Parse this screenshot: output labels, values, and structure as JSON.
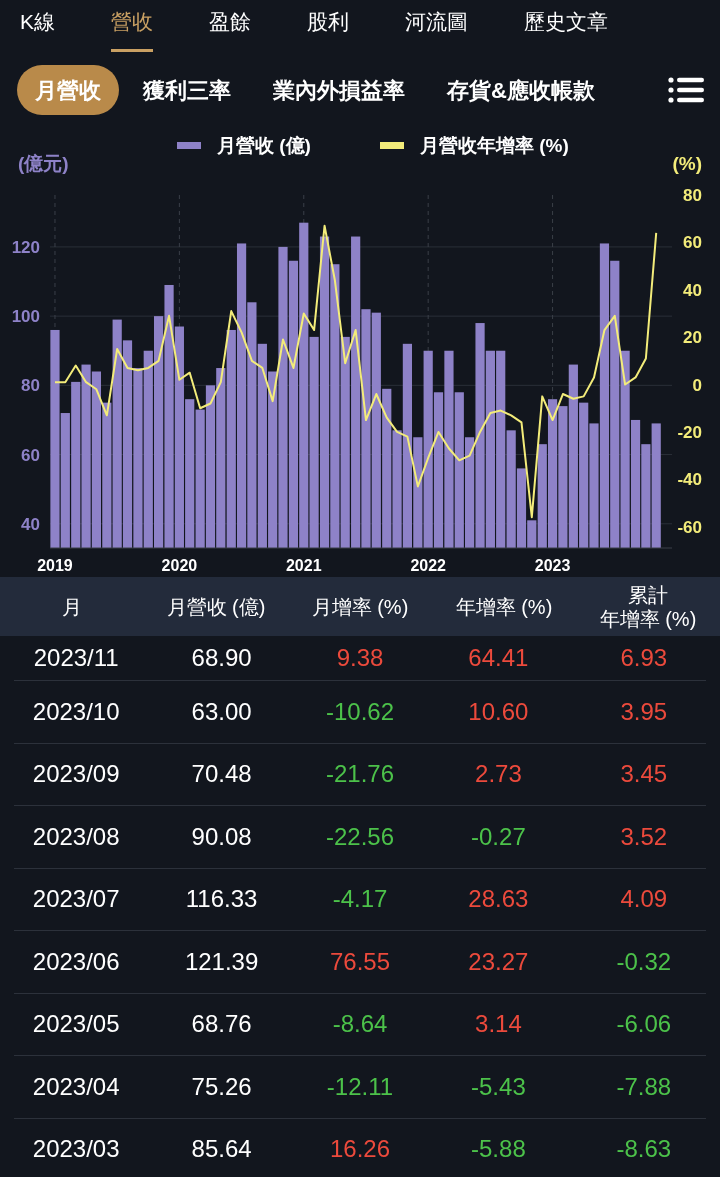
{
  "top_tabs": [
    {
      "label": "K線",
      "selected": false
    },
    {
      "label": "營收",
      "selected": true
    },
    {
      "label": "盈餘",
      "selected": false
    },
    {
      "label": "股利",
      "selected": false
    },
    {
      "label": "河流圖",
      "selected": false
    },
    {
      "label": "歷史文章",
      "selected": false
    }
  ],
  "sub_tabs": [
    {
      "label": "月營收",
      "selected": true
    },
    {
      "label": "獲利三率",
      "selected": false
    },
    {
      "label": "業內外損益率",
      "selected": false
    },
    {
      "label": "存貨&應收帳款",
      "selected": false
    }
  ],
  "charts": [
    {
      "chart_data": {
        "type": "bar",
        "grid": true,
        "ylabel": "(億元)",
        "xlim": [
          2018.96,
          2023.96
        ],
        "ylim": [
          33,
          135
        ],
        "yticks": [
          40,
          60,
          80,
          100,
          120
        ],
        "xticks": [
          2019,
          2020,
          2021,
          2022,
          2023
        ],
        "x": [
          2019,
          2019.083,
          2019.167,
          2019.25,
          2019.333,
          2019.417,
          2019.5,
          2019.583,
          2019.667,
          2019.75,
          2019.833,
          2019.917,
          2020,
          2020.083,
          2020.167,
          2020.25,
          2020.333,
          2020.417,
          2020.5,
          2020.583,
          2020.667,
          2020.75,
          2020.833,
          2020.917,
          2021,
          2021.083,
          2021.167,
          2021.25,
          2021.333,
          2021.417,
          2021.5,
          2021.583,
          2021.667,
          2021.75,
          2021.833,
          2021.917,
          2022,
          2022.083,
          2022.167,
          2022.25,
          2022.333,
          2022.417,
          2022.5,
          2022.583,
          2022.667,
          2022.75,
          2022.833,
          2022.917,
          2023,
          2023.083,
          2023.167,
          2023.25,
          2023.333,
          2023.417,
          2023.5,
          2023.583,
          2023.667,
          2023.75,
          2023.833
        ],
        "series": [
          {
            "name": "月營收 (億)",
            "color": "#8e82c8",
            "values": [
              96,
              72,
              81,
              86,
              84,
              75,
              99,
              93,
              85,
              90,
              100,
              109,
              97,
              76,
              73,
              80,
              85,
              96,
              121,
              104,
              92,
              84,
              120,
              116,
              127,
              94,
              123,
              115,
              94,
              123,
              102,
              101,
              79,
              67,
              92,
              65,
              90,
              78,
              90,
              78,
              65,
              98,
              90,
              90,
              67,
              56,
              41,
              63,
              76,
              74,
              86,
              75,
              69,
              121,
              116,
              90,
              70,
              63,
              69
            ]
          }
        ]
      }
    },
    {
      "chart_data": {
        "type": "line",
        "ylabel": "(%)",
        "ylim": [
          -69,
          80
        ],
        "yticks": [
          -60,
          -40,
          -20,
          0,
          20,
          40,
          60,
          80
        ],
        "series": [
          {
            "name": "月營收年增率 (%)",
            "color": "#f3ec7a",
            "values": [
              1,
              1,
              8,
              1,
              -2,
              -13,
              15,
              7,
              6,
              7,
              10,
              29,
              2,
              5,
              -10,
              -8,
              1,
              31,
              22,
              10,
              7,
              -7,
              19,
              7,
              30,
              23,
              67,
              44,
              9,
              23,
              -15,
              -4,
              -14,
              -20,
              -22,
              -43,
              -31,
              -20,
              -27,
              -32,
              -30,
              -20,
              -12,
              -11,
              -13,
              -16,
              -56,
              -5,
              -15,
              -4,
              -6,
              -5,
              3,
              23,
              29,
              0,
              3,
              11,
              64
            ]
          }
        ]
      }
    }
  ],
  "table": {
    "columns": [
      {
        "lines": [
          "月"
        ]
      },
      {
        "lines": [
          "月營收 (億)"
        ]
      },
      {
        "lines": [
          "月增率 (%)"
        ]
      },
      {
        "lines": [
          "年增率 (%)"
        ]
      },
      {
        "lines": [
          "累計",
          "年增率 (%)"
        ]
      }
    ],
    "rows": [
      {
        "cells": [
          {
            "text": "2023/11",
            "color": "#ffffff"
          },
          {
            "text": "68.90",
            "color": "#ffffff"
          },
          {
            "text": "9.38",
            "color": "#ec4a3c"
          },
          {
            "text": "64.41",
            "color": "#ec4a3c"
          },
          {
            "text": "6.93",
            "color": "#ec4a3c"
          }
        ]
      },
      {
        "cells": [
          {
            "text": "2023/10",
            "color": "#ffffff"
          },
          {
            "text": "63.00",
            "color": "#ffffff"
          },
          {
            "text": "-10.62",
            "color": "#4cc24a"
          },
          {
            "text": "10.60",
            "color": "#ec4a3c"
          },
          {
            "text": "3.95",
            "color": "#ec4a3c"
          }
        ]
      },
      {
        "cells": [
          {
            "text": "2023/09",
            "color": "#ffffff"
          },
          {
            "text": "70.48",
            "color": "#ffffff"
          },
          {
            "text": "-21.76",
            "color": "#4cc24a"
          },
          {
            "text": "2.73",
            "color": "#ec4a3c"
          },
          {
            "text": "3.45",
            "color": "#ec4a3c"
          }
        ]
      },
      {
        "cells": [
          {
            "text": "2023/08",
            "color": "#ffffff"
          },
          {
            "text": "90.08",
            "color": "#ffffff"
          },
          {
            "text": "-22.56",
            "color": "#4cc24a"
          },
          {
            "text": "-0.27",
            "color": "#4cc24a"
          },
          {
            "text": "3.52",
            "color": "#ec4a3c"
          }
        ]
      },
      {
        "cells": [
          {
            "text": "2023/07",
            "color": "#ffffff"
          },
          {
            "text": "116.33",
            "color": "#ffffff"
          },
          {
            "text": "-4.17",
            "color": "#4cc24a"
          },
          {
            "text": "28.63",
            "color": "#ec4a3c"
          },
          {
            "text": "4.09",
            "color": "#ec4a3c"
          }
        ]
      },
      {
        "cells": [
          {
            "text": "2023/06",
            "color": "#ffffff"
          },
          {
            "text": "121.39",
            "color": "#ffffff"
          },
          {
            "text": "76.55",
            "color": "#ec4a3c"
          },
          {
            "text": "23.27",
            "color": "#ec4a3c"
          },
          {
            "text": "-0.32",
            "color": "#4cc24a"
          }
        ]
      },
      {
        "cells": [
          {
            "text": "2023/05",
            "color": "#ffffff"
          },
          {
            "text": "68.76",
            "color": "#ffffff"
          },
          {
            "text": "-8.64",
            "color": "#4cc24a"
          },
          {
            "text": "3.14",
            "color": "#ec4a3c"
          },
          {
            "text": "-6.06",
            "color": "#4cc24a"
          }
        ]
      },
      {
        "cells": [
          {
            "text": "2023/04",
            "color": "#ffffff"
          },
          {
            "text": "75.26",
            "color": "#ffffff"
          },
          {
            "text": "-12.11",
            "color": "#4cc24a"
          },
          {
            "text": "-5.43",
            "color": "#4cc24a"
          },
          {
            "text": "-7.88",
            "color": "#4cc24a"
          }
        ]
      },
      {
        "cells": [
          {
            "text": "2023/03",
            "color": "#ffffff"
          },
          {
            "text": "85.64",
            "color": "#ffffff"
          },
          {
            "text": "16.26",
            "color": "#ec4a3c"
          },
          {
            "text": "-5.88",
            "color": "#4cc24a"
          },
          {
            "text": "-8.63",
            "color": "#4cc24a"
          }
        ]
      }
    ]
  }
}
